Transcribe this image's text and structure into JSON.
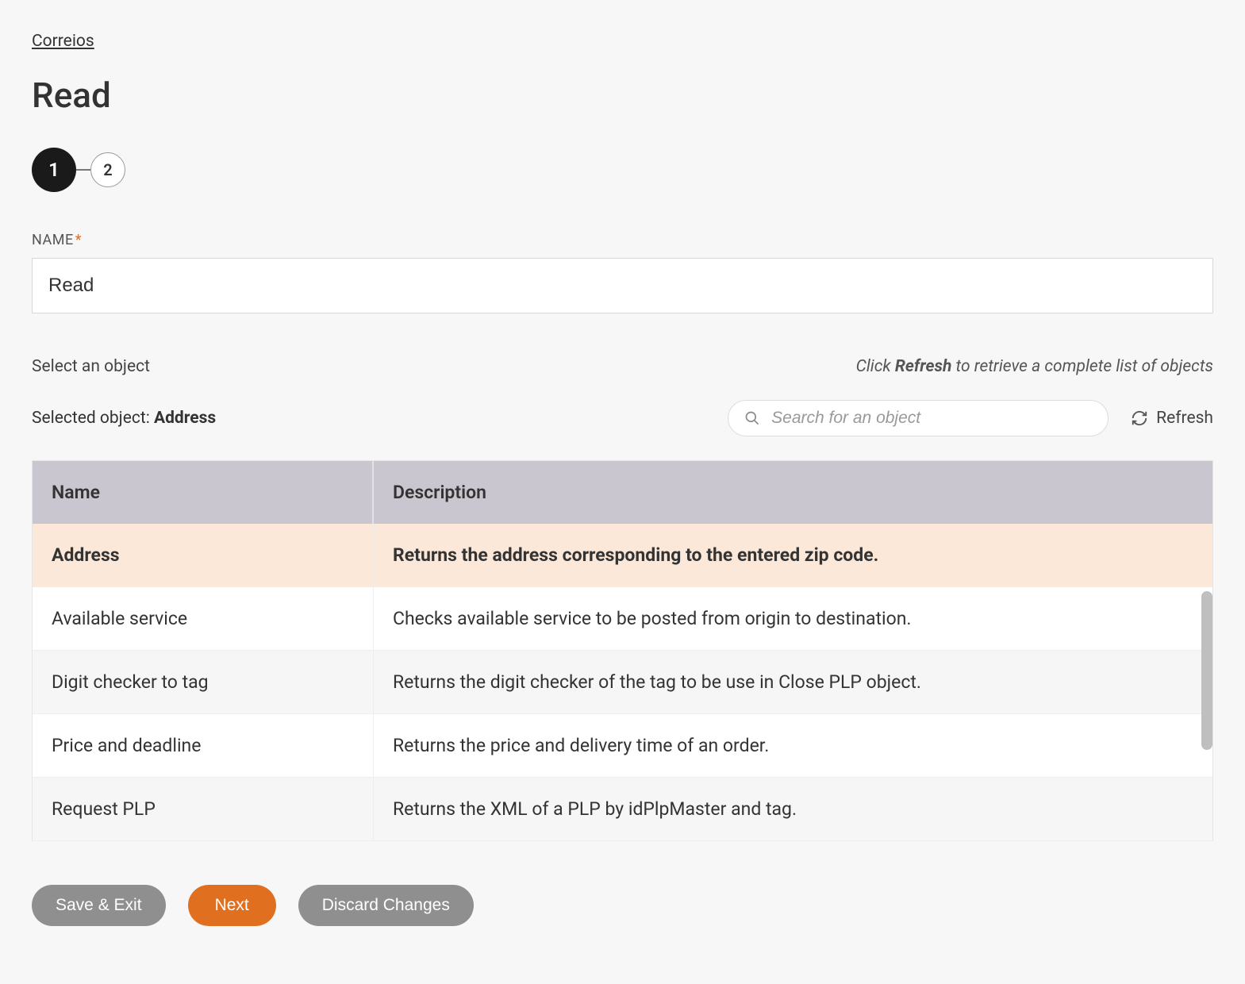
{
  "breadcrumb": {
    "parent": "Correios"
  },
  "page_title": "Read",
  "stepper": {
    "current": "1",
    "next": "2"
  },
  "fields": {
    "name_label": "NAME",
    "name_value": "Read"
  },
  "section": {
    "select_label": "Select an object",
    "hint_prefix": "Click ",
    "hint_bold": "Refresh",
    "hint_suffix": " to retrieve a complete list of objects",
    "selected_prefix": "Selected object: ",
    "selected_value": "Address"
  },
  "search": {
    "placeholder": "Search for an object"
  },
  "refresh_label": "Refresh",
  "table": {
    "columns": {
      "name": "Name",
      "description": "Description"
    },
    "rows": [
      {
        "name": "Address",
        "description": "Returns the address corresponding to the entered zip code.",
        "selected": true
      },
      {
        "name": "Available service",
        "description": "Checks available service to be posted from origin to destination.",
        "selected": false
      },
      {
        "name": "Digit checker to tag",
        "description": "Returns the digit checker of the tag to be use in Close PLP object.",
        "selected": false
      },
      {
        "name": "Price and deadline",
        "description": "Returns the price and delivery time of an order.",
        "selected": false
      },
      {
        "name": "Request PLP",
        "description": "Returns the XML of a PLP by idPlpMaster and tag.",
        "selected": false
      }
    ]
  },
  "buttons": {
    "save_exit": "Save & Exit",
    "next": "Next",
    "discard": "Discard Changes"
  }
}
